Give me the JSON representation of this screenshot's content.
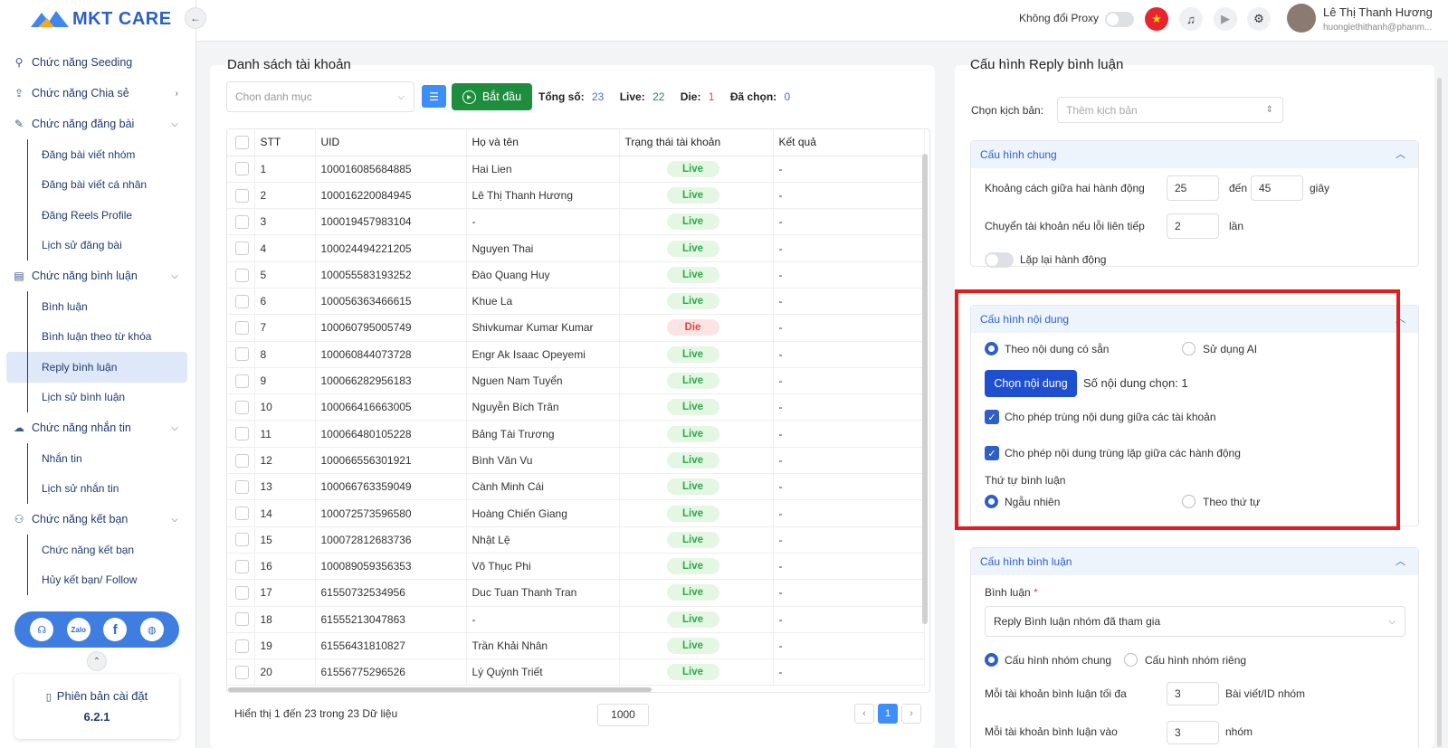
{
  "brand": {
    "name": "MKT CARE",
    "colors": {
      "primary": "#2e5fc9",
      "green": "#1e8e3e",
      "red": "#e81b1b"
    }
  },
  "sidebar": {
    "items": [
      {
        "type": "group",
        "label": "Chức năng Seeding",
        "icon": "seedling-icon",
        "chevron": false
      },
      {
        "type": "group",
        "label": "Chức năng Chia sẻ",
        "icon": "share-icon",
        "chevron": "right"
      },
      {
        "type": "group",
        "label": "Chức năng đăng bài",
        "icon": "post-icon",
        "chevron": "down"
      },
      {
        "type": "sub",
        "label": "Đăng bài viết nhóm"
      },
      {
        "type": "sub",
        "label": "Đăng bài viết cá nhân"
      },
      {
        "type": "sub",
        "label": "Đăng Reels Profile"
      },
      {
        "type": "sub",
        "label": "Lịch sử đăng bài"
      },
      {
        "type": "group",
        "label": "Chức năng bình luận",
        "icon": "comment-icon",
        "chevron": "down"
      },
      {
        "type": "sub",
        "label": "Bình luận"
      },
      {
        "type": "sub",
        "label": "Bình luận theo từ khóa"
      },
      {
        "type": "sub",
        "label": "Reply bình luận",
        "active": true
      },
      {
        "type": "sub",
        "label": "Lịch sử bình luận"
      },
      {
        "type": "group",
        "label": "Chức năng nhắn tin",
        "icon": "chat-icon",
        "chevron": "down"
      },
      {
        "type": "sub",
        "label": "Nhắn tin"
      },
      {
        "type": "sub",
        "label": "Lịch sử nhắn tin"
      },
      {
        "type": "group",
        "label": "Chức năng kết bạn",
        "icon": "add-friend-icon",
        "chevron": "down"
      },
      {
        "type": "sub",
        "label": "Chức năng kết bạn"
      },
      {
        "type": "sub",
        "label": "Hủy kết bạn/ Follow"
      }
    ],
    "social": [
      "support-icon",
      "zalo-icon",
      "facebook-icon",
      "globe-icon"
    ],
    "zalo_label": "Zalo",
    "version_label": "Phiên bản cài đặt",
    "version": "6.2.1"
  },
  "topbar": {
    "proxy_label": "Không đổi Proxy",
    "user_name": "Lê Thị Thanh Hương",
    "user_email": "huonglethithanh@phanm..."
  },
  "accounts": {
    "title": "Danh sách tài khoản",
    "category_placeholder": "Chọn danh mục",
    "start_label": "Bắt đầu",
    "stats": {
      "total_label": "Tổng số:",
      "total": "23",
      "live_label": "Live:",
      "live": "22",
      "die_label": "Die:",
      "die": "1",
      "selected_label": "Đã chọn:",
      "selected": "0"
    },
    "columns": [
      "STT",
      "UID",
      "Họ và tên",
      "Trạng thái tài khoản",
      "Kết quả"
    ],
    "rows": [
      [
        "1",
        "100016085684885",
        "Hai Lien",
        "Live",
        "-"
      ],
      [
        "2",
        "100016220084945",
        "Lê Thị Thanh Hương",
        "Live",
        "-"
      ],
      [
        "3",
        "100019457983104",
        "-",
        "Live",
        "-"
      ],
      [
        "4",
        "100024494221205",
        "Nguyen Thai",
        "Live",
        "-"
      ],
      [
        "5",
        "100055583193252",
        "Đào Quang Huy",
        "Live",
        "-"
      ],
      [
        "6",
        "100056363466615",
        "Khue La",
        "Live",
        "-"
      ],
      [
        "7",
        "100060795005749",
        "Shivkumar Kumar Kumar",
        "Die",
        "-"
      ],
      [
        "8",
        "100060844073728",
        "Engr Ak Isaac Opeyemi",
        "Live",
        "-"
      ],
      [
        "9",
        "100066282956183",
        "Nguen Nam Tuyển",
        "Live",
        "-"
      ],
      [
        "10",
        "100066416663005",
        "Nguyễn Bích Trân",
        "Live",
        "-"
      ],
      [
        "11",
        "100066480105228",
        "Bảng Tài Trương",
        "Live",
        "-"
      ],
      [
        "12",
        "100066556301921",
        "Bình Văn Vu",
        "Live",
        "-"
      ],
      [
        "13",
        "100066763359049",
        "Cành Minh Cái",
        "Live",
        "-"
      ],
      [
        "14",
        "100072573596580",
        "Hoàng Chiến Giang",
        "Live",
        "-"
      ],
      [
        "15",
        "100072812683736",
        "Nhật Lệ",
        "Live",
        "-"
      ],
      [
        "16",
        "100089059356353",
        "Võ Thục Phi",
        "Live",
        "-"
      ],
      [
        "17",
        "61550732534956",
        "Duc Tuan Thanh Tran",
        "Live",
        "-"
      ],
      [
        "18",
        "61555213047863",
        "-",
        "Live",
        "-"
      ],
      [
        "19",
        "61556431810827",
        "Trần Khải Nhân",
        "Live",
        "-"
      ],
      [
        "20",
        "61556775296526",
        "Lý Quỳnh Triết",
        "Live",
        "-"
      ]
    ],
    "footer": "Hiển thị 1 đến 23 trong 23 Dữ liệu",
    "page_size": "1000",
    "current_page": "1",
    "prev": "‹",
    "next": "›"
  },
  "config": {
    "title": "Cấu hình Reply bình luận",
    "script_label": "Chọn kịch bản:",
    "script_placeholder": "Thêm kịch bản",
    "general": {
      "title": "Cấu hình chung",
      "interval_label": "Khoảng cách giữa hai hành động",
      "interval_from": "25",
      "to_label": "đến",
      "interval_to": "45",
      "unit_seconds": "giây",
      "switch_label": "Chuyển tài khoản nếu lỗi liên tiếp",
      "switch_value": "2",
      "unit_times": "lần",
      "repeat_label": "Lặp lại hành động"
    },
    "content": {
      "title": "Cấu hình nội dung",
      "opt_available": "Theo nội dung có sẵn",
      "opt_ai": "Sử dụng AI",
      "choose_btn": "Chọn nội dung",
      "selected_count": "Số nội dung chọn: 1",
      "allow_dup_accounts": "Cho phép trùng nội dung giữa các tài khoản",
      "allow_dup_actions": "Cho phép nội dung trùng lặp giữa các hành động",
      "order_label": "Thứ tự bình luận",
      "order_random": "Ngẫu nhiên",
      "order_seq": "Theo thứ tự"
    },
    "comment": {
      "title": "Cấu hình bình luận",
      "comment_label": "Bình luận",
      "required_mark": "*",
      "comment_value": "Reply Bình luận nhóm đã tham gia",
      "opt_common": "Cấu hình nhóm chung",
      "opt_private": "Cấu hình nhóm riêng",
      "max_label": "Mỗi tài khoản bình luận tối đa",
      "max_value": "3",
      "max_unit": "Bài viết/ID nhóm",
      "into_label": "Mỗi tài khoản bình luận vào",
      "into_value": "3",
      "into_unit": "nhóm"
    }
  }
}
